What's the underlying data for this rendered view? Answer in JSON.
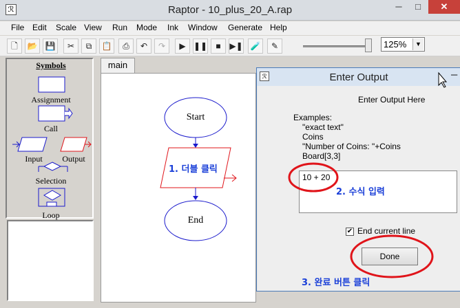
{
  "window": {
    "title": "Raptor - 10_plus_20_A.rap",
    "icon": "raptor-icon"
  },
  "menu": [
    "File",
    "Edit",
    "Scale",
    "View",
    "Run",
    "Mode",
    "Ink",
    "Window",
    "Generate",
    "Help"
  ],
  "toolbar": {
    "buttons": [
      "new-icon",
      "open-icon",
      "save-icon",
      "cut-icon",
      "copy-icon",
      "paste-icon",
      "print-icon",
      "undo-icon",
      "redo-icon",
      "play-icon",
      "pause-icon",
      "stop-icon",
      "step-icon",
      "test-icon",
      "pen-icon"
    ],
    "zoom": "125%"
  },
  "symbols": {
    "title": "Symbols",
    "items": [
      "Assignment",
      "Call",
      "Input",
      "Output",
      "Selection",
      "Loop"
    ]
  },
  "tabs": [
    "main"
  ],
  "flowchart": {
    "start": "Start",
    "end": "End"
  },
  "dialog": {
    "title": "Enter Output",
    "prompt": "Enter Output Here",
    "examples_heading": "Examples:",
    "examples": [
      "\"exact text\"",
      "Coins",
      "\"Number of Coins: \"+Coins",
      "Board[3,3]"
    ],
    "output_value": "10 + 20",
    "checkbox_label": "End current line",
    "checkbox_checked": true,
    "done_label": "Done"
  },
  "annotations": {
    "step1": "1. 더블 클릭",
    "step2": "2. 수식 입력",
    "step3": "3. 완료 버튼 클릭"
  },
  "colors": {
    "annotation": "#1a3fd8",
    "highlight_circle": "#e0141a",
    "flow_shape": "#1a1acc",
    "output_shape": "#e0141a"
  }
}
